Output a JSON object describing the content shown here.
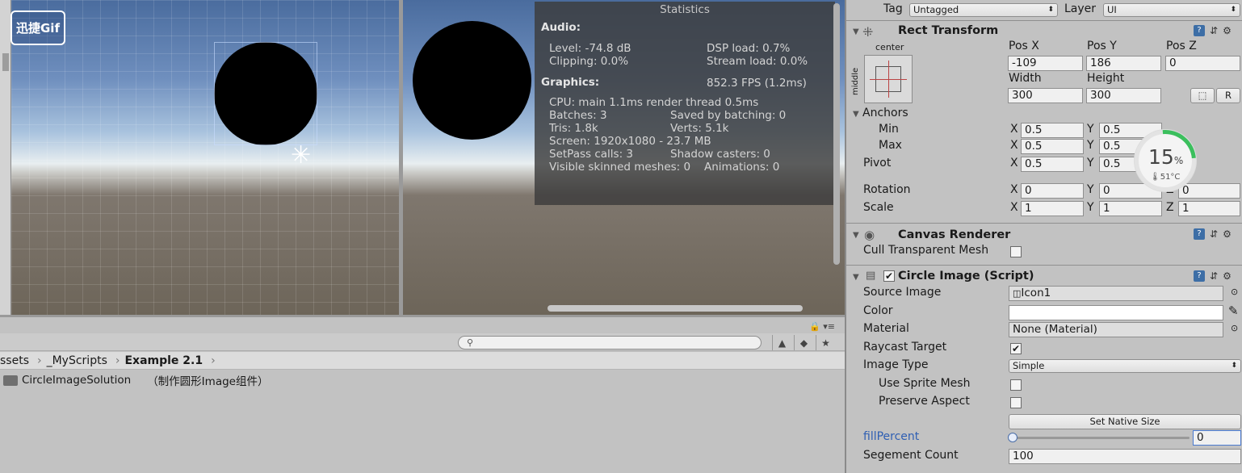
{
  "scene": {
    "logo_text": "迅捷Gif",
    "anchor_glyph": "✳"
  },
  "statistics": {
    "title": "Statistics",
    "audio_header": "Audio:",
    "level": "Level: -74.8 dB",
    "dsp_load": "DSP load: 0.7%",
    "clipping": "Clipping: 0.0%",
    "stream_load": "Stream load: 0.0%",
    "graphics_header": "Graphics:",
    "fps": "852.3 FPS (1.2ms)",
    "cpu": "CPU: main 1.1ms  render thread 0.5ms",
    "batches": "Batches: 3",
    "saved_batching": "Saved by batching: 0",
    "tris": "Tris: 1.8k",
    "verts": "Verts: 5.1k",
    "screen": "Screen: 1920x1080 - 23.7 MB",
    "setpass": "SetPass calls: 3",
    "shadow_casters": "Shadow casters: 0",
    "skinned": "Visible skinned meshes: 0",
    "animations": "Animations: 0"
  },
  "project": {
    "breadcrumb": [
      "ssets",
      "_MyScripts",
      "Example 2.1"
    ],
    "breadcrumb_sep": "›",
    "files": [
      {
        "name": "CircleImageSolution",
        "note": "（制作圆形Image组件）"
      }
    ],
    "lock_glyph": "🔒 ▾≡"
  },
  "inspector": {
    "tag_label": "Tag",
    "tag_value": "Untagged",
    "layer_label": "Layer",
    "layer_value": "UI",
    "rect_transform": {
      "title": "Rect Transform",
      "anchor_h": "center",
      "anchor_v": "middle",
      "pos_x_label": "Pos X",
      "pos_y_label": "Pos Y",
      "pos_z_label": "Pos Z",
      "pos_x": "-109",
      "pos_y": "186",
      "pos_z": "0",
      "width_label": "Width",
      "height_label": "Height",
      "width": "300",
      "height": "300",
      "r_button": "R",
      "anchors_label": "Anchors",
      "min_label": "Min",
      "max_label": "Max",
      "pivot_label": "Pivot",
      "min_x": "0.5",
      "min_y": "0.5",
      "max_x": "0.5",
      "max_y": "0.5",
      "pivot_x": "0.5",
      "pivot_y": "0.5",
      "rotation_label": "Rotation",
      "rot_x": "0",
      "rot_y": "0",
      "rot_z": "0",
      "scale_label": "Scale",
      "scale_x": "1",
      "scale_y": "1",
      "scale_z": "1",
      "x": "X",
      "y": "Y",
      "z": "Z"
    },
    "canvas_renderer": {
      "title": "Canvas Renderer",
      "cull_label": "Cull Transparent Mesh",
      "cull": false
    },
    "circle_image": {
      "title": "Circle Image (Script)",
      "source_image_label": "Source Image",
      "source_image": "Icon1",
      "color_label": "Color",
      "material_label": "Material",
      "material": "None (Material)",
      "raycast_label": "Raycast Target",
      "raycast": true,
      "image_type_label": "Image Type",
      "image_type": "Simple",
      "use_sprite_mesh_label": "Use Sprite Mesh",
      "use_sprite_mesh": false,
      "preserve_aspect_label": "Preserve Aspect",
      "preserve_aspect": false,
      "set_native_size": "Set Native Size",
      "fill_percent_label": "fillPercent",
      "fill_percent": "0",
      "segment_count_label": "Segement Count",
      "segment_count": "100"
    }
  },
  "gauge": {
    "percent": "15",
    "percent_sign": "%",
    "temp": "51°C"
  },
  "colors": {
    "link_blue": "#2f5fb3",
    "gauge_green": "#3bbf5d",
    "stats_bg": "#3c3c3c"
  }
}
